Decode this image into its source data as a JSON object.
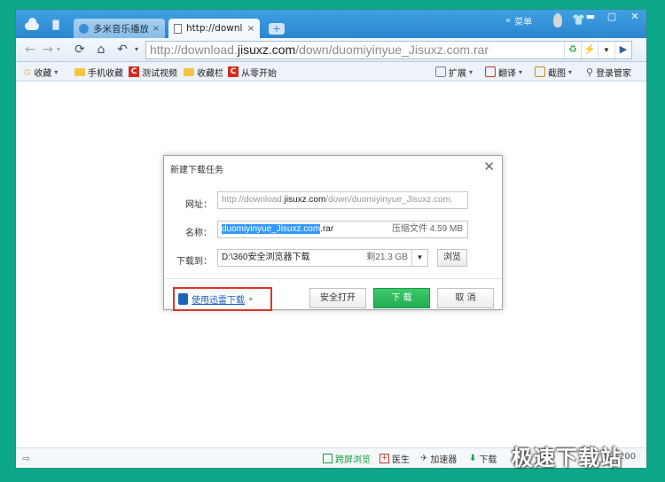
{
  "tabs": [
    {
      "label": "多米音乐播放器",
      "close": "×"
    },
    {
      "label": "http://downlo",
      "close": "×"
    }
  ],
  "window": {
    "menu_label": "菜单",
    "menu_chevrons": "«",
    "minimize": "▬",
    "maximize": "▢",
    "close": "✕"
  },
  "newtab": "+",
  "address": {
    "prefix": "http://download.",
    "domain": "jisuxz.com",
    "suffix": "/down/duomiyinyue_Jisuxz.com.rar"
  },
  "bookmarks": [
    {
      "label": "收藏",
      "icon": "star-icon"
    },
    {
      "label": "手机收藏",
      "icon": "folder-icon"
    },
    {
      "label": "测试视频",
      "icon": "c-icon"
    },
    {
      "label": "收藏栏",
      "icon": "folder-icon"
    },
    {
      "label": "从零开始",
      "icon": "c-icon"
    }
  ],
  "bookmarks_right": [
    {
      "label": "扩展"
    },
    {
      "label": "翻译"
    },
    {
      "label": "截图"
    },
    {
      "label": "登录管家"
    }
  ],
  "dialog": {
    "title": "新建下载任务",
    "close": "✕",
    "url_label": "网址：",
    "url_prefix": "http://download.",
    "url_domain": "jisuxz.com",
    "url_suffix": "/down/duomiyinyue_Jisuxz.com.",
    "name_label": "名称：",
    "name_selected": "duomiyinyue_Jisuxz.com",
    "name_ext": ".rar",
    "file_type_size": "压缩文件 4.59 MB",
    "save_label": "下载到：",
    "save_path": "D:\\360安全浏览器下载",
    "free_space": "剩21.3 GB",
    "browse": "浏览",
    "xunlei": "使用迅雷下载",
    "xunlei_chevron": "»",
    "safe_open": "安全打开",
    "download": "下 载",
    "cancel": "取 消"
  },
  "status": [
    {
      "label": "跨屏浏览",
      "color": "#169a3c"
    },
    {
      "label": "医生"
    },
    {
      "label": "加速器"
    },
    {
      "label": "下载"
    }
  ],
  "status_truncated": "200",
  "watermark": "极速下载站"
}
